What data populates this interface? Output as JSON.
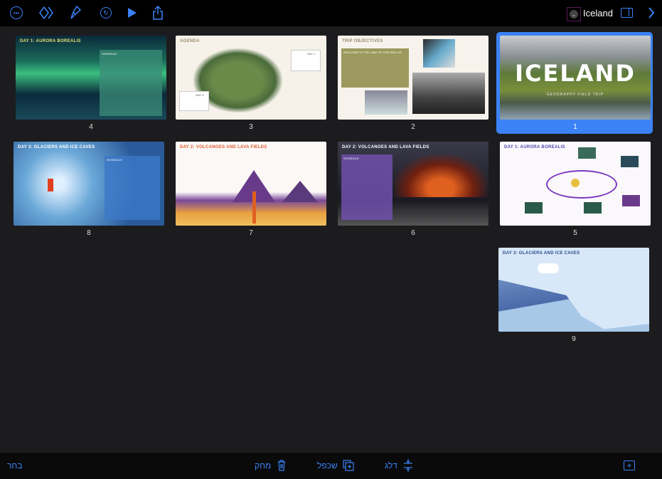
{
  "toolbar": {
    "title": "Iceland",
    "icons": [
      "more-icon",
      "animate-icon",
      "format-brush-icon",
      "undo-icon",
      "play-icon",
      "share-icon",
      "chevron-down-icon",
      "sidebar-icon",
      "chevron-right-icon"
    ]
  },
  "slides": [
    {
      "number": "1",
      "title": "ICELAND",
      "subtitle": "GEOGRAPHY FIELD TRIP",
      "selected": true
    },
    {
      "number": "2",
      "title": "TRIP OBJECTIVES",
      "box": "WELCOME TO THE LAND OF FIRE AND ICE"
    },
    {
      "number": "3",
      "title": "AGENDA",
      "labels": [
        "DAY 1",
        "DAY 3"
      ]
    },
    {
      "number": "4",
      "title": "DAY 1: AURORA BOREALIS",
      "box": "SCHEDULE"
    },
    {
      "number": "5",
      "title": "DAY 1: AURORA BOREALIS"
    },
    {
      "number": "6",
      "title": "DAY 2: VOLCANOES AND LAVA FIELDS",
      "box": "SCHEDULE"
    },
    {
      "number": "7",
      "title": "DAY 2: VOLCANOES AND LAVA FIELDS"
    },
    {
      "number": "8",
      "title": "DAY 3: GLACIERS AND ICE CAVES",
      "box": "SCHEDULE"
    },
    {
      "number": "9",
      "title": "DAY 3: GLACIERS AND ICE CAVES"
    }
  ],
  "bottombar": {
    "select": "בחר",
    "delete": "מחק",
    "duplicate": "שכפל",
    "skip": "דלג"
  },
  "colors": {
    "accent": "#3b82f6",
    "background": "#1c1c1e"
  }
}
